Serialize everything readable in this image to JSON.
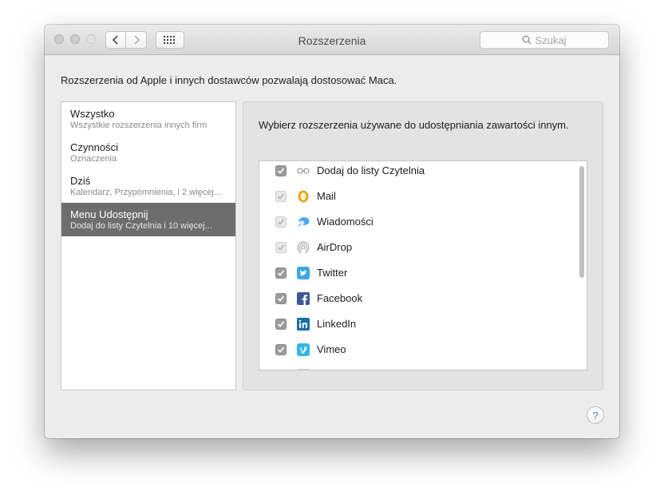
{
  "window": {
    "title": "Rozszerzenia",
    "search_placeholder": "Szukaj"
  },
  "description": "Rozszerzenia od Apple i innych dostawców pozwalają dostosować Maca.",
  "sidebar": {
    "items": [
      {
        "title": "Wszystko",
        "subtitle": "Wszystkie rozszerzenia innych firm"
      },
      {
        "title": "Czynności",
        "subtitle": "Oznaczenia"
      },
      {
        "title": "Dziś",
        "subtitle": "Kalendarz, Przypomnienia, i 2 więcej..."
      },
      {
        "title": "Menu Udostępnij",
        "subtitle": "Dodaj do listy Czytelnia i 10 więcej..."
      }
    ]
  },
  "panel": {
    "instruction": "Wybierz rozszerzenia używane do udostępniania zawartości innym.",
    "extensions": [
      {
        "label": "Dodaj do listy Czytelnia",
        "icon": "reading-list-icon",
        "checked": true
      },
      {
        "label": "Mail",
        "icon": "mail-icon",
        "checked": true
      },
      {
        "label": "Wiadomości",
        "icon": "messages-icon",
        "checked": true
      },
      {
        "label": "AirDrop",
        "icon": "airdrop-icon",
        "checked": true
      },
      {
        "label": "Twitter",
        "icon": "twitter-icon",
        "checked": true
      },
      {
        "label": "Facebook",
        "icon": "facebook-icon",
        "checked": true
      },
      {
        "label": "LinkedIn",
        "icon": "linkedin-icon",
        "checked": true
      },
      {
        "label": "Vimeo",
        "icon": "vimeo-icon",
        "checked": true
      }
    ]
  },
  "help_label": "?",
  "colors": {
    "selection": "#6d6d6d",
    "twitter": "#3ea6e8",
    "facebook": "#3b5998",
    "linkedin": "#1b6fa8",
    "vimeo": "#35b6e6",
    "mail": "#e6a51a"
  }
}
